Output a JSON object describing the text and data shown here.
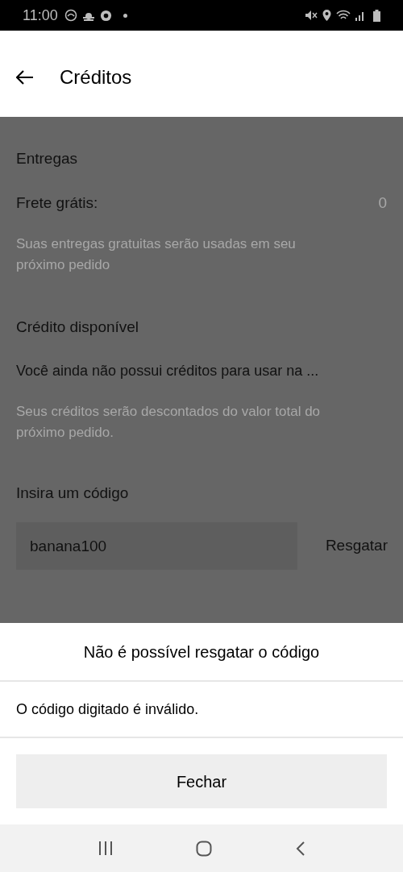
{
  "status_bar": {
    "time": "11:00"
  },
  "header": {
    "title": "Créditos"
  },
  "deliveries": {
    "heading": "Entregas",
    "label": "Frete grátis:",
    "value": "0",
    "note": "Suas entregas gratuitas serão usadas em seu próximo pedido"
  },
  "credit": {
    "heading": "Crédito disponível",
    "message": "Você ainda não possui créditos para usar na ...",
    "note": "Seus créditos serão descontados do valor total do próximo pedido."
  },
  "code": {
    "heading": "Insira um código",
    "value": "banana100",
    "button": "Resgatar"
  },
  "dialog": {
    "title": "Não é possível resgatar o código",
    "message": "O código digitado é inválido.",
    "button": "Fechar"
  }
}
